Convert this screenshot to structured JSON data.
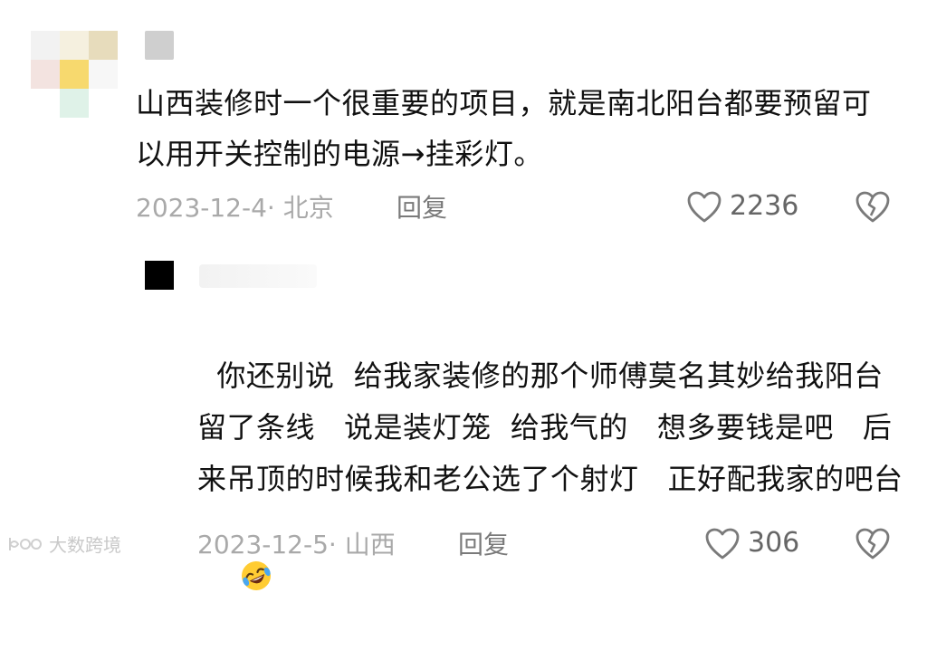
{
  "comment": {
    "text": "山西装修时一个很重要的项目，就是南北阳台都要预留可以用开关控制的电源→挂彩灯。",
    "date_location": "2023-12-4· 北京",
    "reply_label": "回复",
    "likes": "2236"
  },
  "reply": {
    "text": "你还别说  给我家装修的那个师傅莫名其妙给我阳台留了条线   说是装灯笼  给我气的   想多要钱是吧   后来吊顶的时候我和老公选了个射灯   正好配我家的吧台",
    "emoji": "rolling-on-floor-laughing",
    "date_location": "2023-12-5· 山西",
    "reply_label": "回复",
    "likes": "306"
  },
  "watermark": {
    "text": "大数跨境"
  },
  "icons": {
    "like": "heart-outline-icon",
    "dislike": "broken-heart-icon"
  },
  "colors": {
    "meta_text": "#a9a9a9",
    "reply_text": "#7a7a7a",
    "icon_stroke": "#7a7a7a"
  }
}
